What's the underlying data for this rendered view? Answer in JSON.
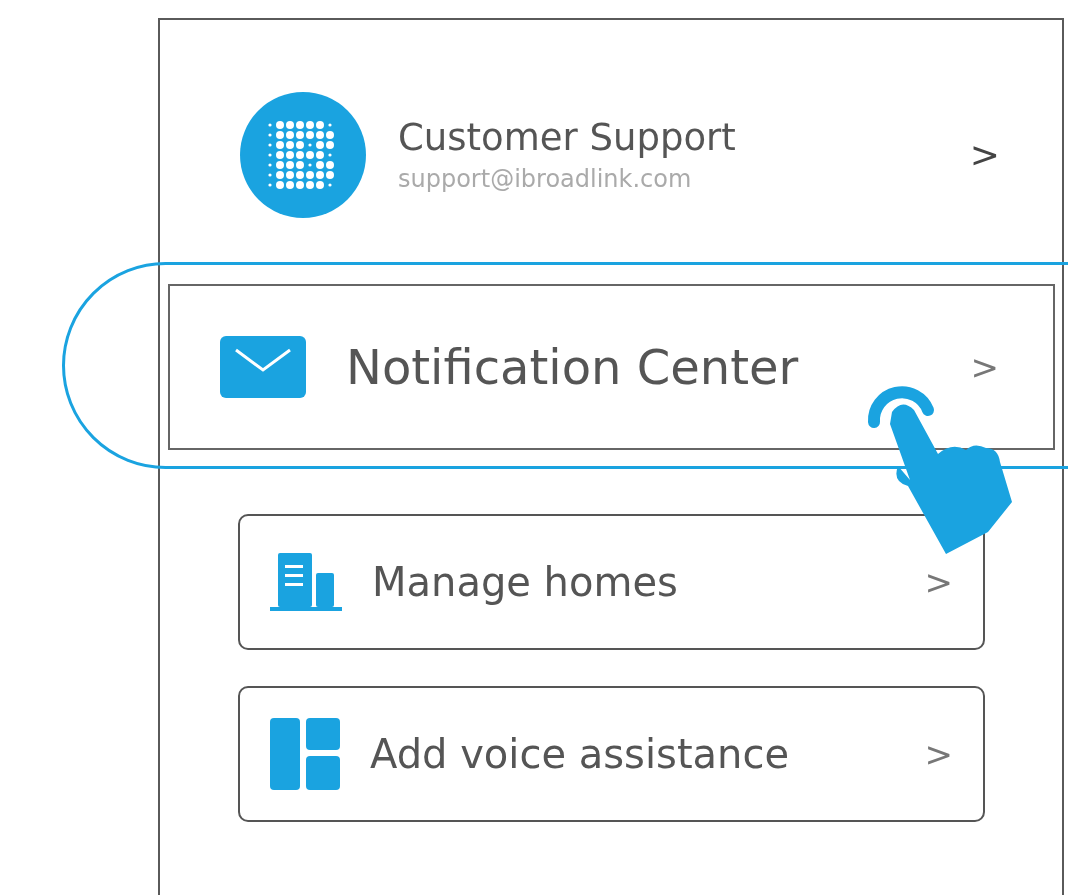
{
  "support": {
    "title": "Customer Support",
    "email": "support@ibroadlink.com",
    "chevron": ">"
  },
  "items": [
    {
      "kind": "notification",
      "label": "Notification Center",
      "chevron": ">",
      "selected": true
    },
    {
      "kind": "homes",
      "label": "Manage homes",
      "chevron": ">",
      "selected": false
    },
    {
      "kind": "voice",
      "label": "Add voice assistance",
      "chevron": ">",
      "selected": false
    }
  ]
}
